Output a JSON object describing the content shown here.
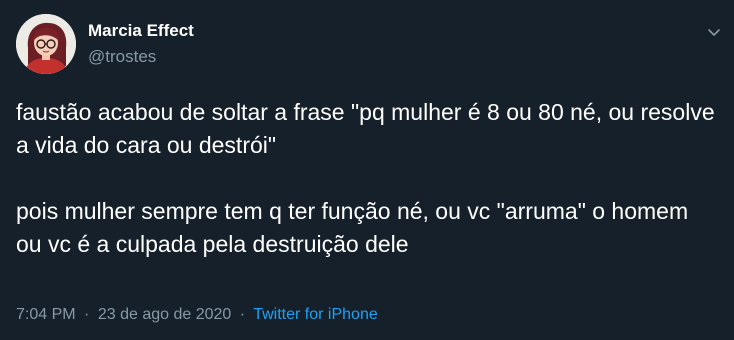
{
  "author": {
    "display_name": "Marcia Effect",
    "handle": "@trostes"
  },
  "icons": {
    "avatar": "avatar-illustration",
    "more": "chevron-down-icon"
  },
  "tweet": {
    "paragraphs": [
      "faustão acabou de soltar a frase \"pq mulher é 8 ou 80 né, ou resolve a vida do cara ou destrói\"",
      "pois mulher sempre tem q ter função né, ou vc \"arruma\" o homem ou vc é a culpada pela destruição dele"
    ]
  },
  "meta": {
    "time": "7:04 PM",
    "separator": "·",
    "date": "23 de ago de 2020",
    "source": "Twitter for iPhone"
  },
  "colors": {
    "background": "#15202b",
    "text": "#ffffff",
    "secondary_text": "#8899a6",
    "link": "#1da1f2"
  }
}
